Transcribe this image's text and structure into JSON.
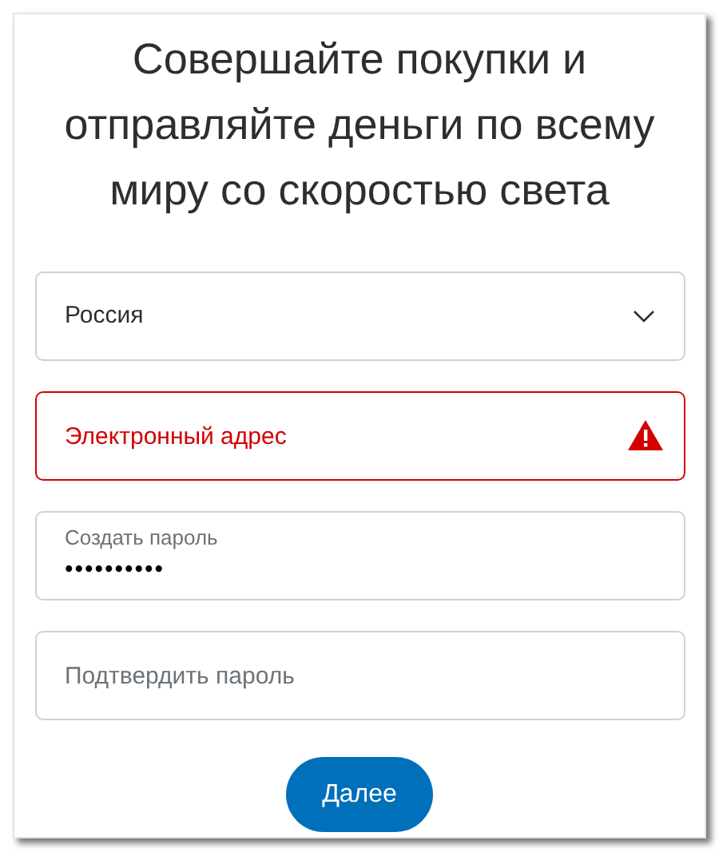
{
  "heading": "Совершайте покупки и отправляйте деньги по всему миру со скоростью света",
  "fields": [
    {
      "kind": "select",
      "value": "Россия"
    },
    {
      "kind": "text",
      "placeholder": "Электронный адрес",
      "error": true
    },
    {
      "kind": "text",
      "label": "Создать пароль",
      "value": "••••••••••",
      "error": false
    },
    {
      "kind": "text",
      "placeholder": "Подтвердить пароль",
      "error": false
    }
  ],
  "button": "Далее"
}
